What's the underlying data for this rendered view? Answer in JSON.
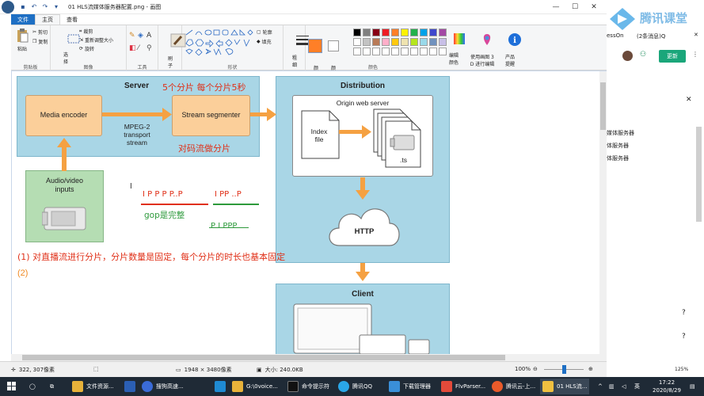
{
  "window": {
    "title": "01 HLS流媒体服务器配置.png - 画图"
  },
  "tabs": [
    {
      "label": "文件"
    },
    {
      "label": "主页"
    },
    {
      "label": "查看"
    }
  ],
  "ribbon": {
    "clipboard": {
      "label": "剪贴板",
      "paste": "粘贴",
      "cut": "剪切",
      "copy": "复制"
    },
    "image": {
      "label": "图像",
      "select": "选\n择",
      "crop": "裁剪",
      "resize": "重新调整大小",
      "rotate": "旋转"
    },
    "tools": {
      "label": "工具"
    },
    "brush": {
      "label": "刷\n子"
    },
    "shapes": {
      "label": "形状",
      "outline": "轮廓",
      "fill": "填充"
    },
    "size": {
      "label": "粗\n细"
    },
    "color1": "颜\n色 1",
    "color2": "颜\n色 2",
    "colors_label": "颜色",
    "edit_colors": "编辑\n颜色",
    "paint3d": "使用画图 3\nD 进行编辑",
    "product_alert": "产品\n提醒",
    "palette_row1": [
      "#000000",
      "#7f7f7f",
      "#880015",
      "#ed1c24",
      "#ff7f27",
      "#fff200",
      "#22b14c",
      "#00a2e8",
      "#3f48cc",
      "#a349a4"
    ],
    "palette_row2": [
      "#ffffff",
      "#c3c3c3",
      "#b97a57",
      "#ffaec9",
      "#ffc90e",
      "#efe4b0",
      "#b5e61d",
      "#99d9ea",
      "#7092be",
      "#c8bfe7"
    ],
    "color1_value": "#ff7f27",
    "color2_value": "#ffffff"
  },
  "diagram": {
    "server_label": "Server",
    "distribution_label": "Distribution",
    "client_label": "Client",
    "media_encoder": "Media encoder",
    "stream_segmenter": "Stream segmenter",
    "mpeg_label": "MPEG-2\ntransport\nstream",
    "audio_video": "Audio/video\ninputs",
    "origin_web_server": "Origin web server",
    "index_file": "Index\nfile",
    "ts_label": ".ts",
    "http_label": "HTTP",
    "note_segments": "5个分片    每个分片5秒",
    "note_segment_stream": "对码流做分片",
    "gop_seq1": "I  P  P  P  P..P",
    "gop_seq2": "I  PP  ..P",
    "gop_note": "gop是完整",
    "ppp_note": "P  I  PPP",
    "note_1": "(1) 对直播流进行分片，分片数量是固定，每个分片的时长也基本固定",
    "note_2": "(2)"
  },
  "statusbar": {
    "cursor_pos": "322, 307像素",
    "dimensions": "1948 × 3480像素",
    "file_size": "大小: 240.0KB",
    "zoom": "100%"
  },
  "side_panel": {
    "logo_text": "腾讯课堂",
    "tab1": "essOn",
    "tab2": "(2条消息)Q",
    "update_btn": "更新",
    "item1": "媒体服务器",
    "item2": "体服务器",
    "item3": "体服务器"
  },
  "taskbar": {
    "items": [
      {
        "label": "文件资源..."
      },
      {
        "label": ""
      },
      {
        "label": "搜狗高速..."
      },
      {
        "label": ""
      },
      {
        "label": "G:\\0voice..."
      },
      {
        "label": "命令提示符"
      },
      {
        "label": "腾讯QQ"
      },
      {
        "label": "下载管理器"
      },
      {
        "label": "FlvParser..."
      },
      {
        "label": "腾讯云-上..."
      },
      {
        "label": "01 HLS流..."
      }
    ],
    "time": "17:22",
    "date": "2020/8/29"
  }
}
